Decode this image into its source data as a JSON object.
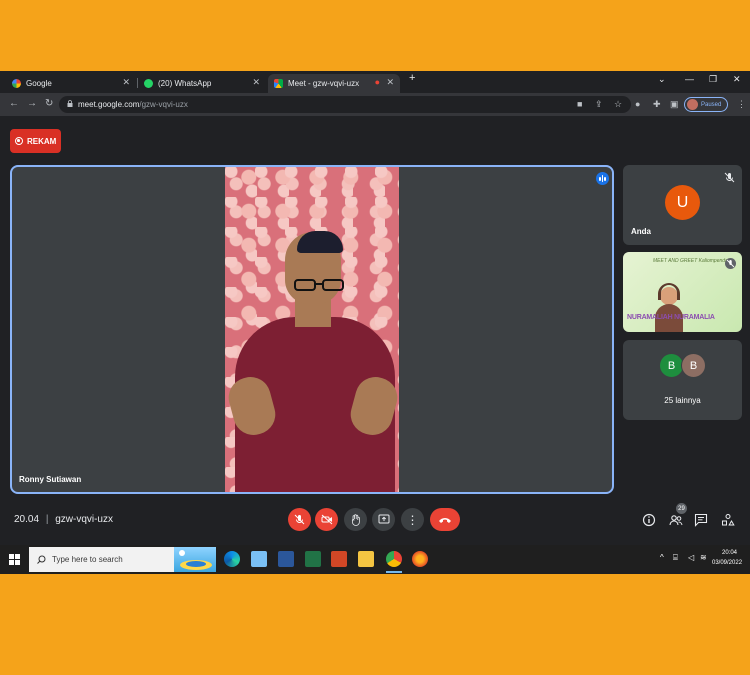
{
  "browser": {
    "tabs": [
      {
        "label": "Google",
        "favicon_color": "#ea4335",
        "active": false
      },
      {
        "label": "(20) WhatsApp",
        "favicon_color": "#25d366",
        "active": false
      },
      {
        "label": "Meet - gzw-vqvi-uzx",
        "favicon_color": "#00ac47",
        "active": true
      }
    ],
    "url_host": "meet.google.com",
    "url_path": "/gzw-vqvi-uzx",
    "profile_label": "Paused"
  },
  "meet": {
    "record_label": "REKAM",
    "speaker_name": "Ronny Sutiawan",
    "self_label": "Anda",
    "self_initial": "U",
    "presenter_name": "NURAMALIAH NURAMALIA",
    "slide_title": "MEET AND GREET Kaliompendana",
    "others_label": "25 lainnya",
    "others_initials": [
      "B",
      "B"
    ],
    "time": "20.04",
    "meeting_code": "gzw-vqvi-uzx",
    "participant_count": "29",
    "colors": {
      "accent": "#8ab4f8",
      "danger": "#ea4335",
      "avatar_u": "#e8590c",
      "avatar_b1": "#1e8e3e",
      "avatar_b2": "#8d6e63"
    }
  },
  "taskbar": {
    "search_placeholder": "Type here to search",
    "clock_time": "20:04",
    "clock_date": "03/09/2022"
  }
}
